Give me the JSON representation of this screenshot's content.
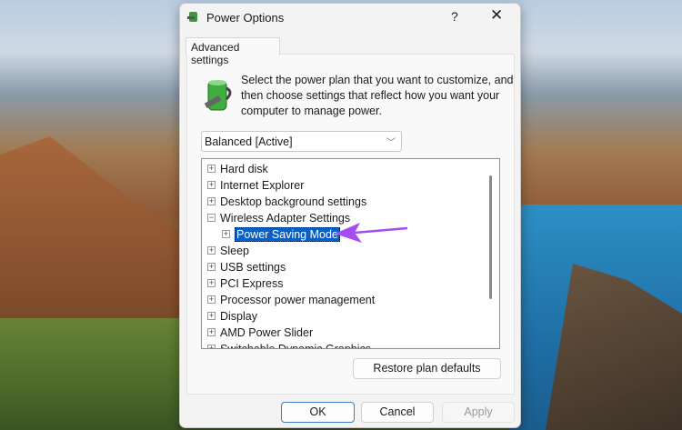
{
  "window": {
    "title": "Power Options",
    "help": "?",
    "close": "✕"
  },
  "tab": "Advanced settings",
  "description": "Select the power plan that you want to customize, and then choose settings that reflect how you want your computer to manage power.",
  "plan_select": {
    "value": "Balanced [Active]"
  },
  "tree": [
    {
      "label": "Hard disk",
      "toggle": "+"
    },
    {
      "label": "Internet Explorer",
      "toggle": "+"
    },
    {
      "label": "Desktop background settings",
      "toggle": "+"
    },
    {
      "label": "Wireless Adapter Settings",
      "toggle": "−"
    },
    {
      "label": "Power Saving Mode",
      "toggle": "+",
      "selected": true
    },
    {
      "label": "Sleep",
      "toggle": "+"
    },
    {
      "label": "USB settings",
      "toggle": "+"
    },
    {
      "label": "PCI Express",
      "toggle": "+"
    },
    {
      "label": "Processor power management",
      "toggle": "+"
    },
    {
      "label": "Display",
      "toggle": "+"
    },
    {
      "label": "AMD Power Slider",
      "toggle": "+"
    },
    {
      "label": "Switchable Dynamic Graphics",
      "toggle": "+"
    }
  ],
  "buttons": {
    "restore": "Restore plan defaults",
    "ok": "OK",
    "cancel": "Cancel",
    "apply": "Apply"
  },
  "colors": {
    "selection": "#0a5fc0",
    "annotation_arrow": "#a64df0"
  }
}
